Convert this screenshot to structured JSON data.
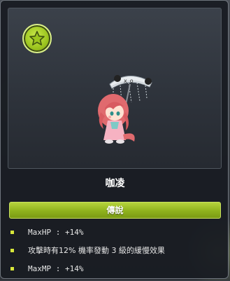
{
  "item": {
    "badge_icon": "star-icon",
    "name": "咖凌",
    "grade": "傳說",
    "colors": {
      "grade_bar": "#9cc51f",
      "bullet": "#d7e63a",
      "tooltip_bg": "#181c22"
    },
    "stats": [
      "MaxHP : +14%",
      "攻擊時有12% 機率發動 3 級的緩慢效果",
      "MaxMP : +14%"
    ]
  }
}
